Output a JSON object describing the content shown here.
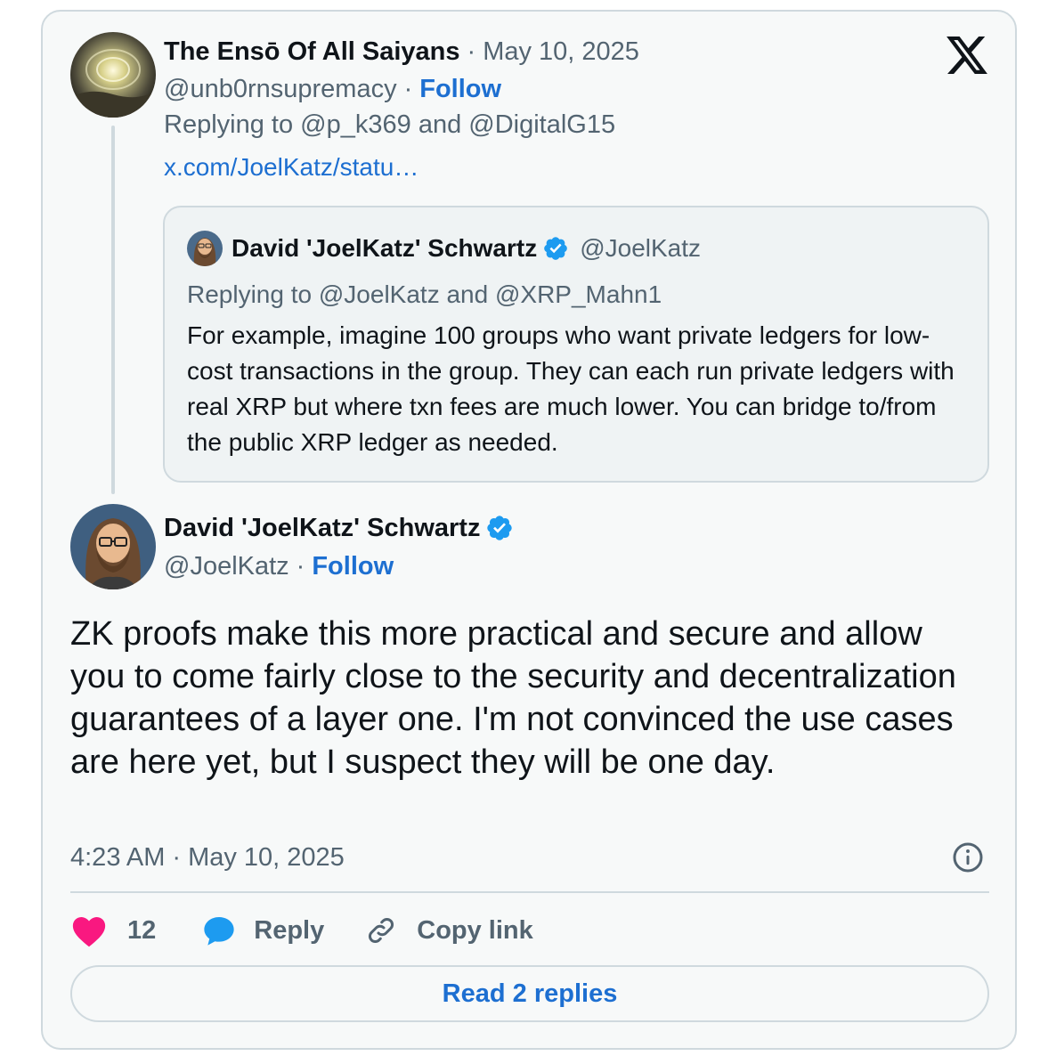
{
  "parent_tweet": {
    "author_name": "The Ensō Of All Saiyans",
    "date": "May 10, 2025",
    "handle": "@unb0rnsupremacy",
    "follow_label": "Follow",
    "replying_prefix": "Replying to",
    "replying_user_1": "@p_k369",
    "replying_and": "and",
    "replying_user_2": "@DigitalG15",
    "link_text": "x.com/JoelKatz/statu…",
    "avatar_icon": "cosmic-vortex-avatar"
  },
  "quoted_tweet": {
    "author_name": "David 'JoelKatz' Schwartz",
    "handle": "@JoelKatz",
    "replying_prefix": "Replying to",
    "replying_user_1": "@JoelKatz",
    "replying_and": "and",
    "replying_user_2": "@XRP_Mahn1",
    "text": "For example, imagine 100 groups who want private ledgers for low-cost transactions in the group. They can each run private ledgers with real XRP but where txn fees are much lower. You can bridge to/from the public XRP ledger as needed."
  },
  "main_tweet": {
    "author_name": "David 'JoelKatz' Schwartz",
    "handle": "@JoelKatz",
    "follow_label": "Follow",
    "text": "ZK proofs make this more practical and secure and allow you to come fairly close to the security and decentralization guarantees of a layer one. I'm not convinced the use cases are here yet, but I suspect they will be one day.",
    "time": "4:23 AM",
    "date": "May 10, 2025"
  },
  "actions": {
    "like_count": "12",
    "reply_label": "Reply",
    "copy_link_label": "Copy link"
  },
  "read_replies_label": "Read 2 replies",
  "separator": "·",
  "colors": {
    "link_blue": "#1d6fd1",
    "verified_blue": "#1d9bf0",
    "like_pink": "#f91880",
    "muted_text": "#536471",
    "border": "#cfd9de"
  }
}
